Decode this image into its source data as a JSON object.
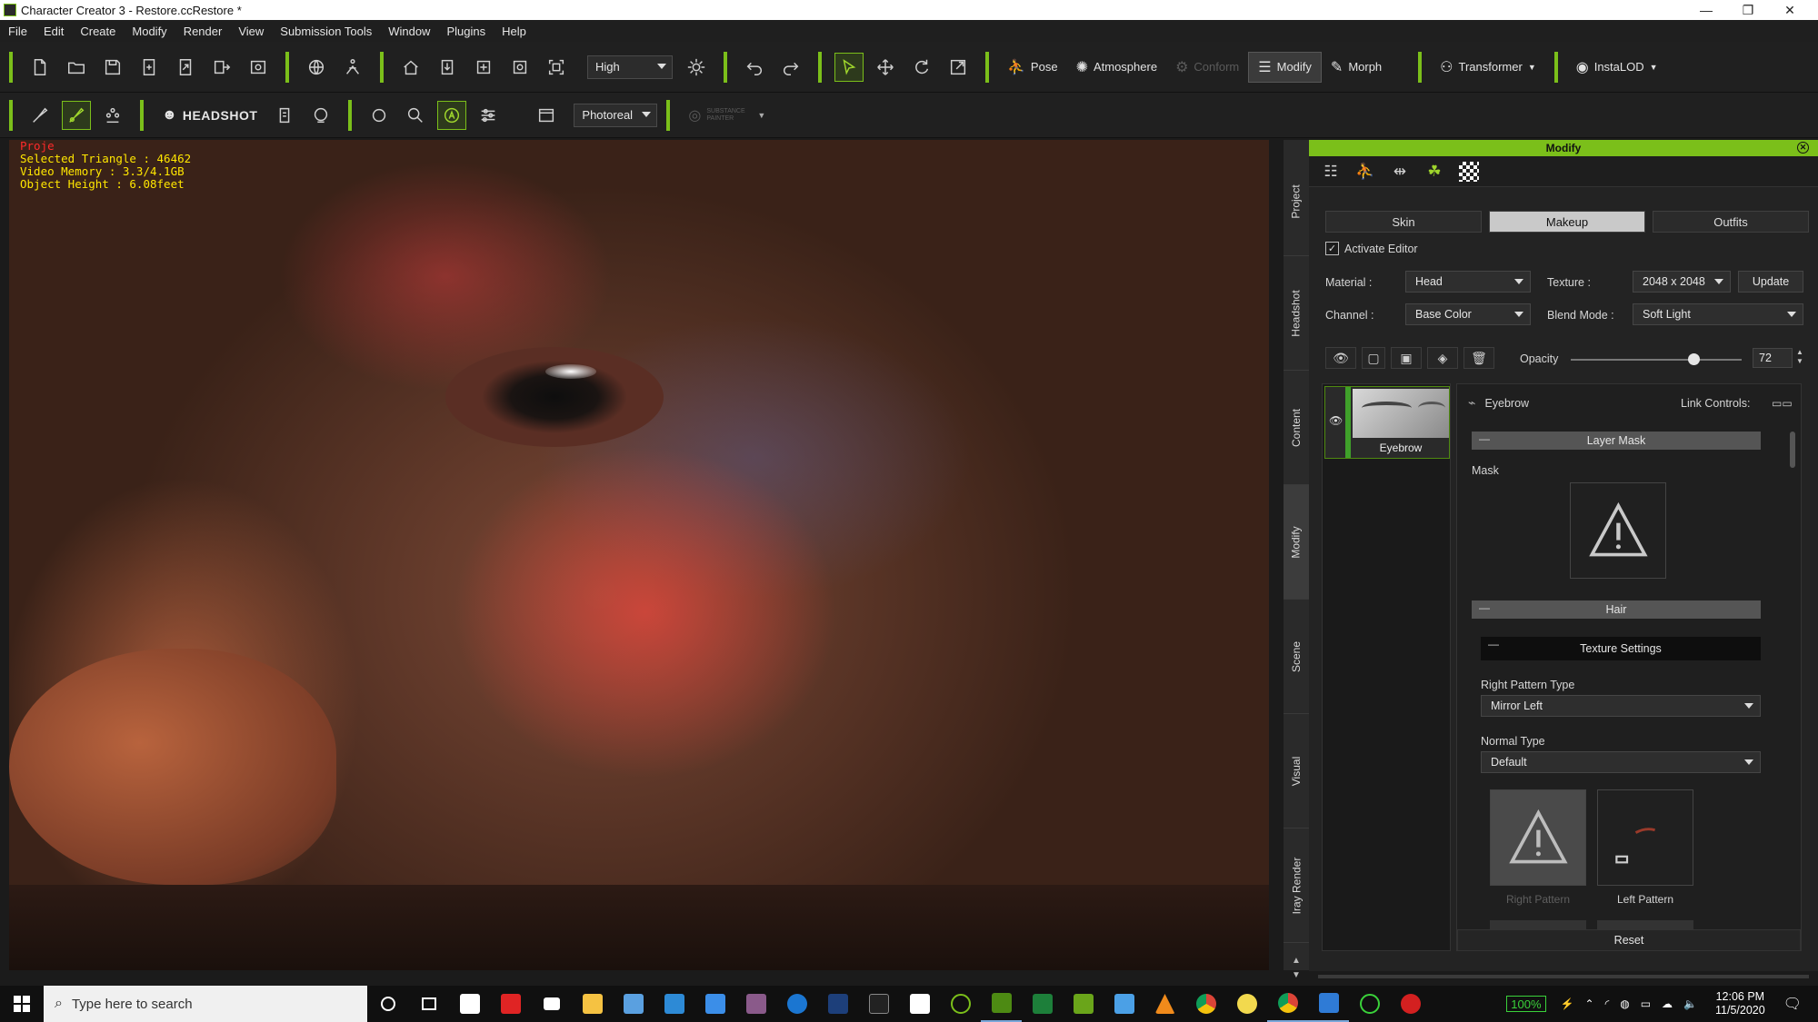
{
  "window": {
    "title": "Character Creator 3 - Restore.ccRestore *",
    "controls": [
      "—",
      "❐",
      "✕"
    ]
  },
  "menu": [
    "File",
    "Edit",
    "Create",
    "Modify",
    "Render",
    "View",
    "Submission Tools",
    "Window",
    "Plugins",
    "Help"
  ],
  "toolbar1": {
    "quality": "High",
    "pose": "Pose",
    "atmosphere": "Atmosphere",
    "conform": "Conform",
    "modify": "Modify",
    "morph": "Morph",
    "transformer": "Transformer",
    "instalod": "InstaLOD"
  },
  "toolbar2": {
    "headshot": "HEADSHOT",
    "render_mode": "Photoreal",
    "substance": "SUBSTANCE PAINTER"
  },
  "viewport_info": {
    "project": "Proje",
    "selected_triangle": "Selected Triangle : 46462",
    "video_memory": "Video Memory : 3.3/4.1GB",
    "object_height": "Object Height : 6.08feet"
  },
  "side_tabs": [
    "Project",
    "Headshot",
    "Content",
    "Modify",
    "Scene",
    "Visual",
    "Iray Render"
  ],
  "panel": {
    "title": "Modify",
    "tabs": [
      "Skin",
      "Makeup",
      "Outfits"
    ],
    "active_tab": "Makeup",
    "activate_editor": "Activate Editor",
    "activate_editor_checked": true,
    "material_label": "Material :",
    "material_value": "Head",
    "texture_label": "Texture :",
    "texture_value": "2048 x 2048",
    "update_button": "Update",
    "channel_label": "Channel :",
    "channel_value": "Base Color",
    "blend_label": "Blend Mode :",
    "blend_value": "Soft Light",
    "opacity_label": "Opacity",
    "opacity_value": "72",
    "opacity_level": 0.72,
    "layer_name": "Eyebrow",
    "selected_layer": "Eyebrow",
    "link_controls": "Link Controls:",
    "layer_mask": "Layer Mask",
    "mask_label": "Mask",
    "hair_section": "Hair",
    "texture_settings": "Texture Settings",
    "right_pattern_type_label": "Right Pattern Type",
    "right_pattern_type_value": "Mirror Left",
    "normal_type_label": "Normal Type",
    "normal_type_value": "Default",
    "right_pattern": "Right Pattern",
    "left_pattern": "Left Pattern",
    "reset": "Reset"
  },
  "taskbar": {
    "search_placeholder": "Type here to search",
    "battery": "100%",
    "time": "12:06 PM",
    "date": "11/5/2020"
  },
  "colors": {
    "accent": "#7bbf1a",
    "overlay_text": "#ffe600",
    "overlay_red": "#ff2a2a"
  }
}
